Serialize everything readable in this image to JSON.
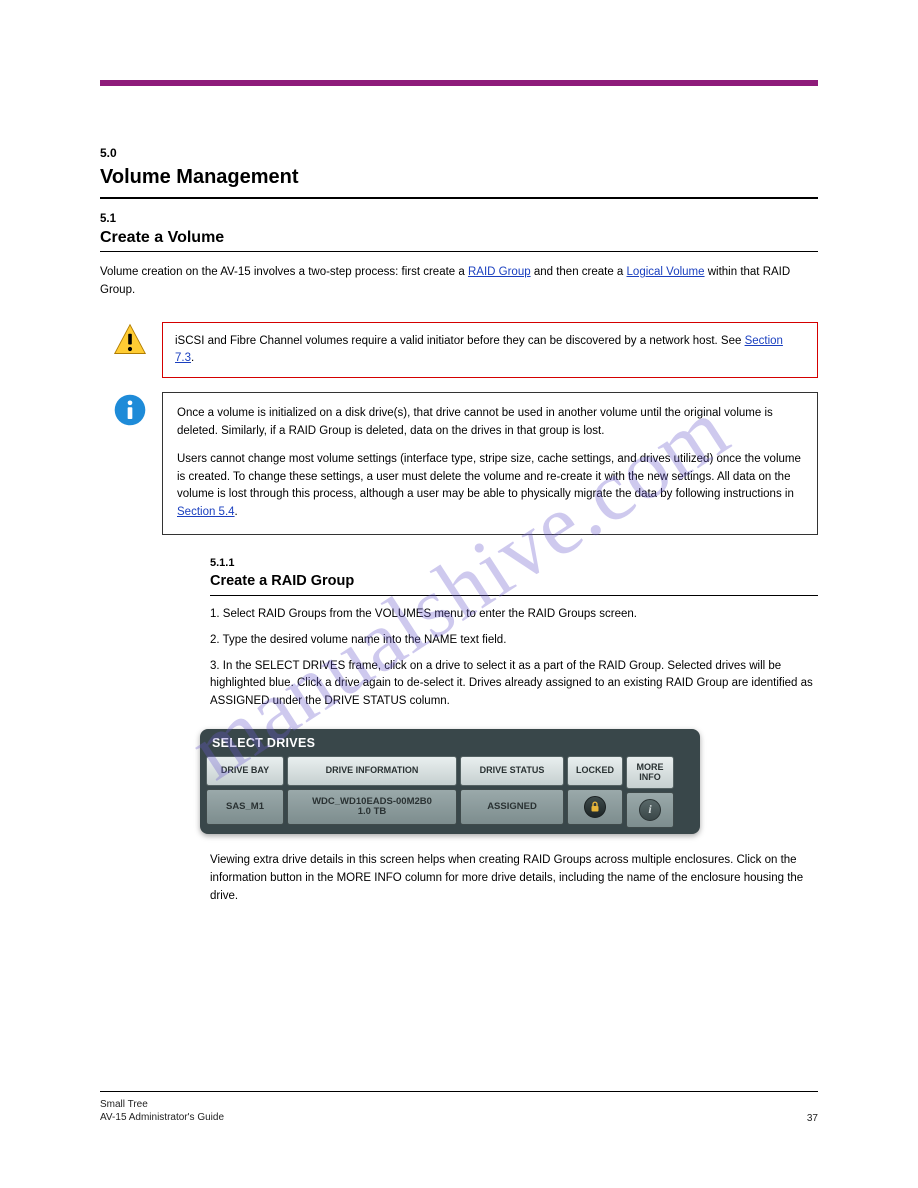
{
  "watermark": "manualshive.com",
  "section": {
    "num": "5.0",
    "title": "Volume Management"
  },
  "subsection": {
    "num": "5.1",
    "title": "Create a Volume",
    "intro_pre": "Volume creation on the AV-15 involves a two-step process: first create a ",
    "intro_link1": "RAID Group",
    "intro_mid": " and then create a ",
    "intro_link2": "Logical Volume",
    "intro_post": " within that RAID Group.",
    "link1_href": "Section 5.1.1",
    "link2_href": "Section 5.1.2"
  },
  "warning": {
    "text_pre": "iSCSI and Fibre Channel volumes require a valid initiator before they can be discovered by a network host. See ",
    "link_text": "Section 7.3",
    "text_post": "."
  },
  "note": {
    "p1": "Once a volume is initialized on a disk drive(s), that drive cannot be used in another volume until the original volume is deleted. Similarly, if a RAID Group is deleted, data on the drives in that group is lost.",
    "p2_pre": "Users cannot change most volume settings (interface type, stripe size, cache settings, and drives utilized) once the volume is created. To change these settings, a user must delete the volume and re-create it with the new settings. All data on the volume is lost through this process, although a user may be able to physically migrate the data by following instructions in ",
    "p2_link": "Section 5.4",
    "p2_post": "."
  },
  "inner": {
    "num": "5.1.1",
    "title": "Create a RAID Group",
    "step1": "1. Select RAID Groups from the VOLUMES menu to enter the RAID Groups screen.",
    "step2": "2. Type the desired volume name into the NAME text field.",
    "step3": "3. In the SELECT DRIVES frame, click on a drive to select it as a part of the RAID Group. Selected drives will be highlighted blue. Click a drive again to de-select it. Drives already assigned to an existing RAID Group are identified as ASSIGNED under the DRIVE STATUS column."
  },
  "drive_panel": {
    "header": "SELECT DRIVES",
    "cols": {
      "bay": "DRIVE BAY",
      "info": "DRIVE INFORMATION",
      "status": "DRIVE STATUS",
      "locked": "LOCKED",
      "more": "MORE\nINFO"
    },
    "row": {
      "bay": "SAS_M1",
      "info": "WDC_WD10EADS-00M2B0\n1.0 TB",
      "status": "ASSIGNED",
      "lock_icon": "lock-icon",
      "info_icon": "i"
    }
  },
  "inner_after": "Viewing extra drive details in this screen helps when creating RAID Groups across multiple enclosures. Click on the information button in the MORE INFO column for more drive details, including the name of the enclosure housing the drive.",
  "footer": {
    "line1": "Small Tree",
    "line2": "AV-15 Administrator's Guide",
    "page": "37"
  }
}
